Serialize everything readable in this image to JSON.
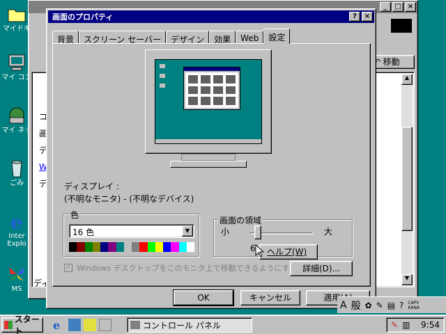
{
  "desktop": {
    "icons": [
      {
        "label": "マイドキ"
      },
      {
        "label": "マイ コン"
      },
      {
        "label": "マイ ネッ"
      },
      {
        "label": "ごみ"
      },
      {
        "label": "Inter Explo"
      },
      {
        "label": "MS"
      }
    ]
  },
  "bg_window": {
    "toolbar_move": "移動",
    "side_chars": [
      "コ",
      "画",
      "デ",
      "W",
      "デ",
      "ディ"
    ]
  },
  "dialog": {
    "title": "画面のプロパティ",
    "help_glyph": "?",
    "close_glyph": "×",
    "tabs": [
      "背景",
      "スクリーン セーバー",
      "デザイン",
      "効果",
      "Web",
      "設定"
    ],
    "active_tab": "設定",
    "display_label": "ディスプレイ :",
    "display_value": "(不明なモニタ) - (不明なデバイス)",
    "color_group": "色",
    "color_value": "16 色",
    "palette": [
      "#000000",
      "#800000",
      "#008000",
      "#808000",
      "#000080",
      "#800080",
      "#008080",
      "#c0c0c0",
      "#808080",
      "#ff0000",
      "#00ff00",
      "#ffff00",
      "#0000ff",
      "#ff00ff",
      "#00ffff",
      "#ffffff"
    ],
    "area_group": "画面の領域",
    "area_small": "小",
    "area_large": "大",
    "area_value_fragment": "6",
    "tooltip": "ヘルプ(W)",
    "checkbox_label": "Windows デスクトップをこのモニタ上で移動できるようにする",
    "checkbox_checked": true,
    "advanced_button": "詳細(D)...",
    "ok_button": "OK",
    "cancel_button": "キャンセル",
    "apply_button": "適用(A)"
  },
  "taskbar": {
    "start_label": "スタート",
    "task_label": "コントロール パネル",
    "clock": "9:54",
    "ime_label": "般",
    "caps_label": "CAPS KANA"
  }
}
